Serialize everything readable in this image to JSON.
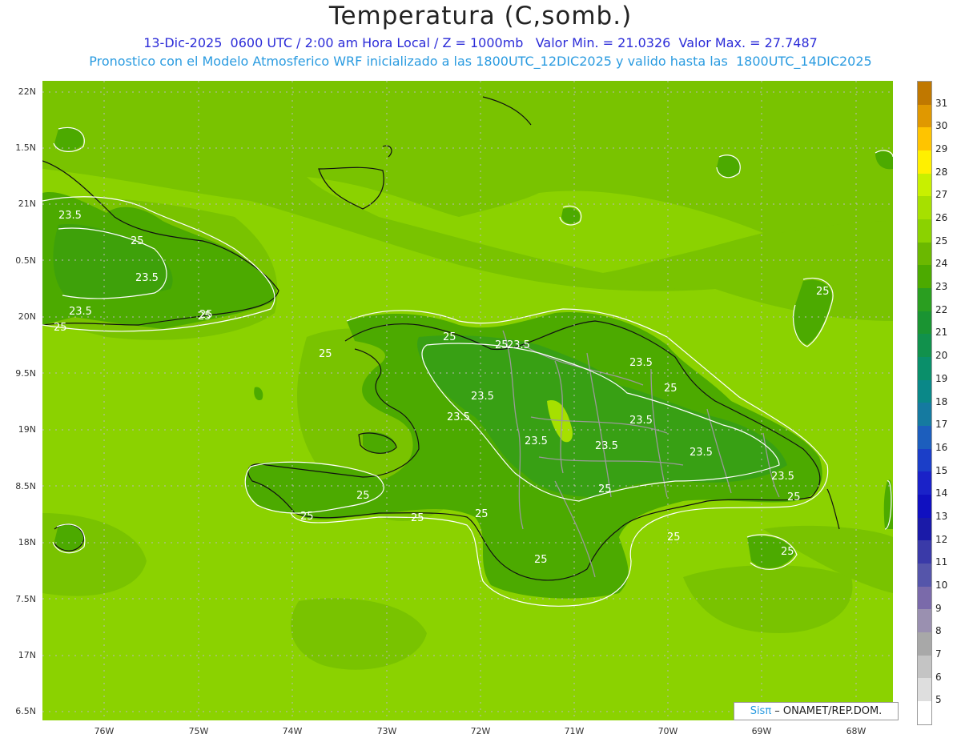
{
  "title": "Temperatura (C,somb.)",
  "subtitle_line1": "13-Dic-2025  0600 UTC / 2:00 am Hora Local / Z = 1000mb   Valor Min. = 21.0326  Valor Max. = 27.7487",
  "subtitle_line2": "Pronostico con el Modelo Atmosferico WRF inicializado a las 1800UTC_12DIC2025 y valido hasta las  1800UTC_14DIC2025",
  "lat_labels": [
    "22N",
    "1.5N",
    "21N",
    "0.5N",
    "20N",
    "9.5N",
    "19N",
    "8.5N",
    "18N",
    "7.5N",
    "17N",
    "6.5N"
  ],
  "lon_labels": [
    "76W",
    "75W",
    "74W",
    "73W",
    "72W",
    "71W",
    "70W",
    "69W",
    "68W"
  ],
  "colorbar": {
    "labels": [
      "31",
      "30",
      "29",
      "28",
      "27",
      "26",
      "25",
      "24",
      "23",
      "22",
      "21",
      "20",
      "19",
      "18",
      "17",
      "16",
      "15",
      "14",
      "13",
      "12",
      "11",
      "10",
      "9",
      "8",
      "7",
      "6",
      "5"
    ],
    "colors": [
      "#c07800",
      "#e09800",
      "#ffc400",
      "#fff000",
      "#c8f000",
      "#a6e000",
      "#8bd200",
      "#6bb800",
      "#4caa00",
      "#2a9e20",
      "#1a9432",
      "#11914c",
      "#0a8f6a",
      "#0a8888",
      "#157aa0",
      "#1c5ebd",
      "#1b3ec8",
      "#1a22c8",
      "#1010c0",
      "#1a1aa8",
      "#3a3aa8",
      "#5555aa",
      "#7a6aaa",
      "#9a90b0",
      "#a8a8a8",
      "#c4c4c4",
      "#dedede",
      "#ffffff"
    ]
  },
  "contour_labels": [
    "23.5",
    "25",
    "25",
    "23.5",
    "23.5",
    "25",
    "25",
    "25",
    "25",
    "23.5",
    "23.5",
    "23.5",
    "23.5",
    "23.5",
    "23.5",
    "23.5",
    "25",
    "25",
    "23.5",
    "25",
    "25",
    "25",
    "25",
    "25",
    "25",
    "25",
    "25",
    "23.5",
    "25",
    "25"
  ],
  "credit": {
    "sis": "Sisπ",
    "rest": " – ONAMET/REP.DOM."
  }
}
